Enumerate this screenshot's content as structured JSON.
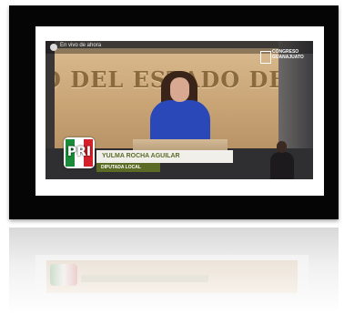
{
  "video": {
    "live_label": "En vivo de ahora",
    "wall_text": "O DEL ESTADO DE G",
    "congress_label": "CONGRESO GUANAJUATO",
    "party_logo_text": "PRI",
    "speaker_name": "YULMA ROCHA AGUILAR",
    "speaker_role": "DIPUTADA LOCAL",
    "colors": {
      "party_green": "#1a8a3a",
      "party_red": "#d3202a",
      "name_plate_text": "#5d6b2a",
      "role_plate_bg": "#5b6a24",
      "speaker_dress": "#2a48b8"
    }
  }
}
